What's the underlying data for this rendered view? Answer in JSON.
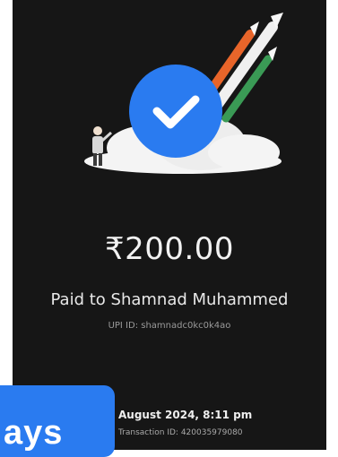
{
  "payment": {
    "amount": "₹200.00",
    "paid_to": "Paid to Shamnad Muhammed",
    "upi_id": "UPI ID: shamnadc0kc0k4ao",
    "date_time": "August 2024, 8:11 pm",
    "transaction_id": "Transaction ID: 420035979080"
  },
  "overlay": {
    "badge_text": "ays"
  },
  "icons": {
    "success": "check-circle-icon"
  },
  "colors": {
    "background": "#161616",
    "accent": "#2a7bf0",
    "badge": "#2a7bf0"
  }
}
